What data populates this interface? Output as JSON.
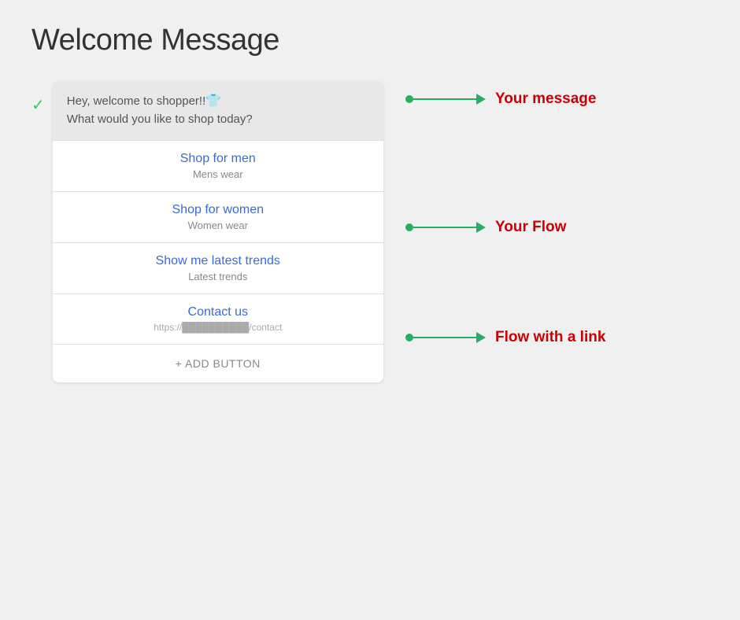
{
  "page": {
    "title": "Welcome Message",
    "checkmark": "✓"
  },
  "message": {
    "text_line1": "Hey, welcome to shopper!!",
    "shirt_emoji": "👕",
    "text_line2": "What would you like to shop today?"
  },
  "buttons": [
    {
      "title": "Shop for men",
      "subtitle": "Mens wear"
    },
    {
      "title": "Shop for women",
      "subtitle": "Women wear"
    },
    {
      "title": "Show me latest trends",
      "subtitle": "Latest trends"
    },
    {
      "title": "Contact us",
      "subtitle": "https://██████████/contact",
      "isUrl": true
    }
  ],
  "add_button_label": "+ ADD BUTTON",
  "annotations": [
    {
      "id": "message",
      "label": "Your message"
    },
    {
      "id": "flow",
      "label": "Your Flow"
    },
    {
      "id": "link",
      "label": "Flow with a link"
    }
  ]
}
